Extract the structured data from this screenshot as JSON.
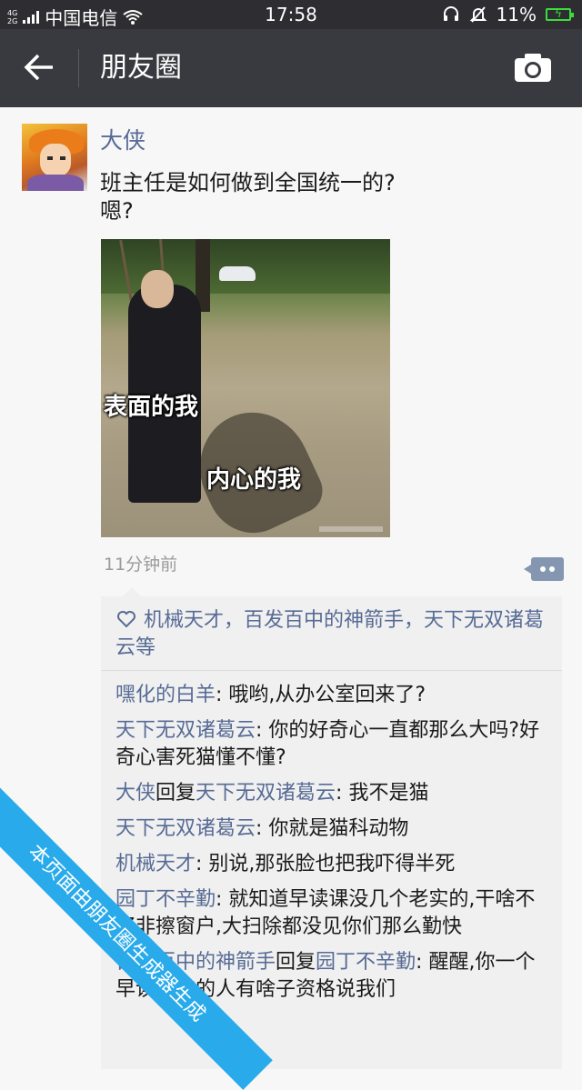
{
  "status_bar": {
    "network": "4G\n2G",
    "carrier": "中国电信",
    "time": "17:58",
    "battery": "11%"
  },
  "nav": {
    "title": "朋友圈"
  },
  "post": {
    "author": "大侠",
    "text_lines": [
      "班主任是如何做到全国统一的?",
      "嗯?"
    ],
    "image_captions": [
      "表面的我",
      "内心的我"
    ],
    "time": "11分钟前"
  },
  "likes": {
    "names": "机械天才，百发百中的神箭手，天下无双诸葛云等"
  },
  "comments": [
    {
      "user": "嘿化的白羊",
      "reply_word": "",
      "target": "",
      "text": ": 哦哟,从办公室回来了?"
    },
    {
      "user": "天下无双诸葛云",
      "reply_word": "",
      "target": "",
      "text": ": 你的好奇心一直都那么大吗?好奇心害死猫懂不懂?"
    },
    {
      "user": "大侠",
      "reply_word": "回复",
      "target": "天下无双诸葛云",
      "text": ": 我不是猫"
    },
    {
      "user": "天下无双诸葛云",
      "reply_word": "",
      "target": "",
      "text": ": 你就是猫科动物"
    },
    {
      "user": "机械天才",
      "reply_word": "",
      "target": "",
      "text": ": 别说,那张脸也把我吓得半死"
    },
    {
      "user": "园丁不辛勤",
      "reply_word": "",
      "target": "",
      "text": ": 就知道早读课没几个老实的,干啥不好非擦窗户,大扫除都没见你们那么勤快"
    },
    {
      "user": "百发百中的神箭手",
      "reply_word": "回复",
      "target": "园丁不辛勤",
      "text": ": 醒醒,你一个早读不在的人有啥子资格说我们"
    }
  ],
  "watermark": "本页面由朋友圈生成器生成",
  "colors": {
    "link": "#576b95",
    "navbar": "#393a3f",
    "banner": "#28aaeb"
  }
}
